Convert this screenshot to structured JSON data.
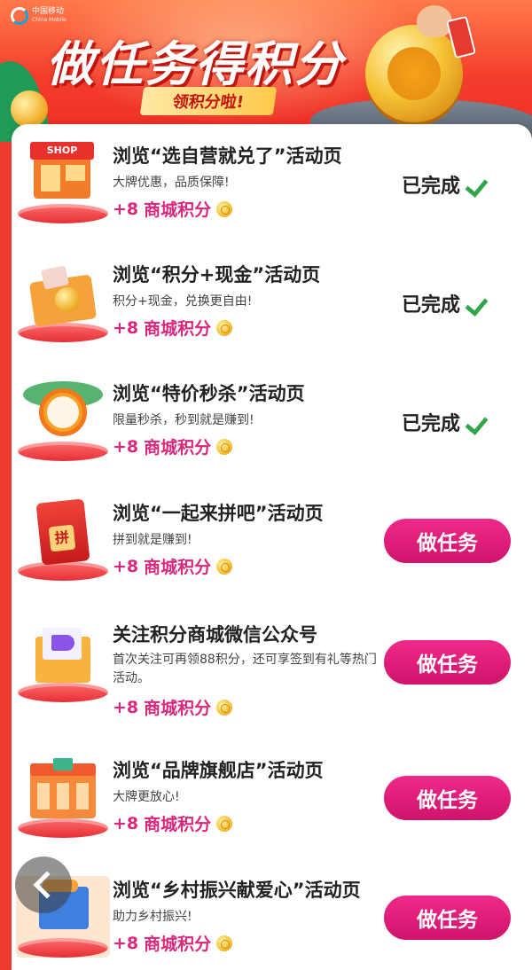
{
  "banner": {
    "carrier_logo": "中国移动",
    "carrier_logo_en": "China Mobile",
    "title": "做任务得积分",
    "subtitle": "领积分啦!"
  },
  "tasks": [
    {
      "title": "浏览“选自营就兑了”活动页",
      "desc": "大牌优惠，品质保障!",
      "reward_plus": "+8",
      "reward_label": "商城积分",
      "status": "已完成",
      "done": true,
      "icon": "shop-icon"
    },
    {
      "title": "浏览“积分+现金”活动页",
      "desc": "积分+现金，兑换更自由!",
      "reward_plus": "+8",
      "reward_label": "商城积分",
      "status": "已完成",
      "done": true,
      "icon": "gift-box-icon"
    },
    {
      "title": "浏览“特价秒杀”活动页",
      "desc": "限量秒杀，秒到就是赚到!",
      "reward_plus": "+8",
      "reward_label": "商城积分",
      "status": "已完成",
      "done": true,
      "icon": "alarm-clock-icon"
    },
    {
      "title": "浏览“一起来拼吧”活动页",
      "desc": "拼到就是赚到!",
      "reward_plus": "+8",
      "reward_label": "商城积分",
      "button": "做任务",
      "done": false,
      "icon": "red-envelope-icon"
    },
    {
      "title": "关注积分商城微信公众号",
      "desc": "首次关注可再领88积分，还可享签到有礼等热门活动。",
      "reward_plus": "+8",
      "reward_label": "商城积分",
      "button": "做任务",
      "done": false,
      "icon": "megaphone-icon"
    },
    {
      "title": "浏览“品牌旗舰店”活动页",
      "desc": "大牌更放心!",
      "reward_plus": "+8",
      "reward_label": "商城积分",
      "button": "做任务",
      "done": false,
      "icon": "storefront-icon"
    },
    {
      "title": "浏览“乡村振兴献爱心”活动页",
      "desc": "助力乡村振兴!",
      "reward_plus": "+8",
      "reward_label": "商城积分",
      "button": "做任务",
      "done": false,
      "icon": "charity-box-icon"
    }
  ],
  "colors": {
    "accent": "#d9277c",
    "button": "#e0187a",
    "done_check": "#2fa64a",
    "background": "#ef3b2f"
  }
}
